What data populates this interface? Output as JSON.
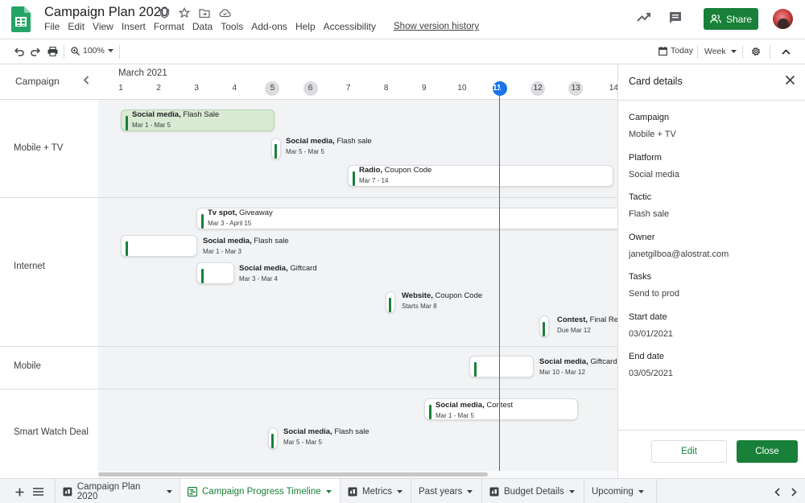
{
  "app": {
    "title": "Campaign Plan 2020",
    "menu": [
      "File",
      "Edit",
      "View",
      "Insert",
      "Format",
      "Data",
      "Tools",
      "Add-ons",
      "Help",
      "Accessibility"
    ],
    "version_history": "Show version history",
    "share_label": "Share",
    "brand_color": "#188038"
  },
  "toolbar": {
    "zoom": "100%",
    "today_label": "Today",
    "view_label": "Week"
  },
  "timeline": {
    "header_label": "Campaign",
    "month": "March 2021",
    "days": [
      {
        "n": "1",
        "state": "normal"
      },
      {
        "n": "2",
        "state": "normal"
      },
      {
        "n": "3",
        "state": "normal"
      },
      {
        "n": "4",
        "state": "normal"
      },
      {
        "n": "5",
        "state": "weekend"
      },
      {
        "n": "6",
        "state": "weekend"
      },
      {
        "n": "7",
        "state": "normal"
      },
      {
        "n": "8",
        "state": "normal"
      },
      {
        "n": "9",
        "state": "normal"
      },
      {
        "n": "10",
        "state": "normal"
      },
      {
        "n": "11",
        "state": "today"
      },
      {
        "n": "12",
        "state": "weekend"
      },
      {
        "n": "13",
        "state": "weekend"
      },
      {
        "n": "14",
        "state": "normal"
      }
    ],
    "groups": [
      "Mobile + TV",
      "Internet",
      "Mobile",
      "Smart Watch Deal"
    ],
    "cards": [
      {
        "bold": "Social media,",
        "rest": " Flash Sale",
        "date": "Mar 1 - Mar 5",
        "selected": true
      },
      {
        "bold": "Social media,",
        "rest": " Flash sale",
        "date": "Mar 5 - Mar 5",
        "selected": false
      },
      {
        "bold": "Radio,",
        "rest": " Coupon Code",
        "date": "Mar 7 - 14",
        "selected": false
      },
      {
        "bold": "Tv spot,",
        "rest": " Giveaway",
        "date": "Mar 3 - April 15",
        "selected": false
      },
      {
        "bold": "Social media,",
        "rest": " Flash sale",
        "date": "Mar 1 - Mar 3",
        "selected": false
      },
      {
        "bold": "Social media,",
        "rest": " Giftcard",
        "date": "Mar 3 - Mar 4",
        "selected": false
      },
      {
        "bold": "Website,",
        "rest": " Coupon Code",
        "date": "Starts Mar 8",
        "selected": false
      },
      {
        "bold": "Contest,",
        "rest": " Final Re",
        "date": "Due Mar 12",
        "selected": false
      },
      {
        "bold": "Social media,",
        "rest": " Giftcard",
        "date": "Mar 10 - Mar 12",
        "selected": false
      },
      {
        "bold": "Social media,",
        "rest": " Contest",
        "date": "Mar 1 - Mar 5",
        "selected": false
      },
      {
        "bold": "Social media,",
        "rest": " Flash sale",
        "date": "Mar 5 - Mar 5",
        "selected": false
      }
    ]
  },
  "details": {
    "title": "Card details",
    "fields": [
      {
        "label": "Campaign",
        "value": "Mobile + TV"
      },
      {
        "label": "Platform",
        "value": "Social media"
      },
      {
        "label": "Tactic",
        "value": "Flash sale"
      },
      {
        "label": "Owner",
        "value": "janetgilboa@alostrat.com"
      },
      {
        "label": "Tasks",
        "value": "Send to prod"
      },
      {
        "label": "Start date",
        "value": "03/01/2021"
      },
      {
        "label": "End date",
        "value": "03/05/2021"
      }
    ],
    "edit_label": "Edit",
    "close_label": "Close"
  },
  "sheets": [
    {
      "label": "Campaign Plan 2020",
      "icon": "sheet-icon",
      "active": false
    },
    {
      "label": "Campaign Progress Timeline",
      "icon": "timeline-icon",
      "active": true
    },
    {
      "label": "Metrics",
      "icon": "sheet-icon",
      "active": false
    },
    {
      "label": "Past years",
      "icon": "",
      "active": false
    },
    {
      "label": "Budget Details",
      "icon": "sheet-icon",
      "active": false
    },
    {
      "label": "Upcoming",
      "icon": "",
      "active": false
    }
  ]
}
